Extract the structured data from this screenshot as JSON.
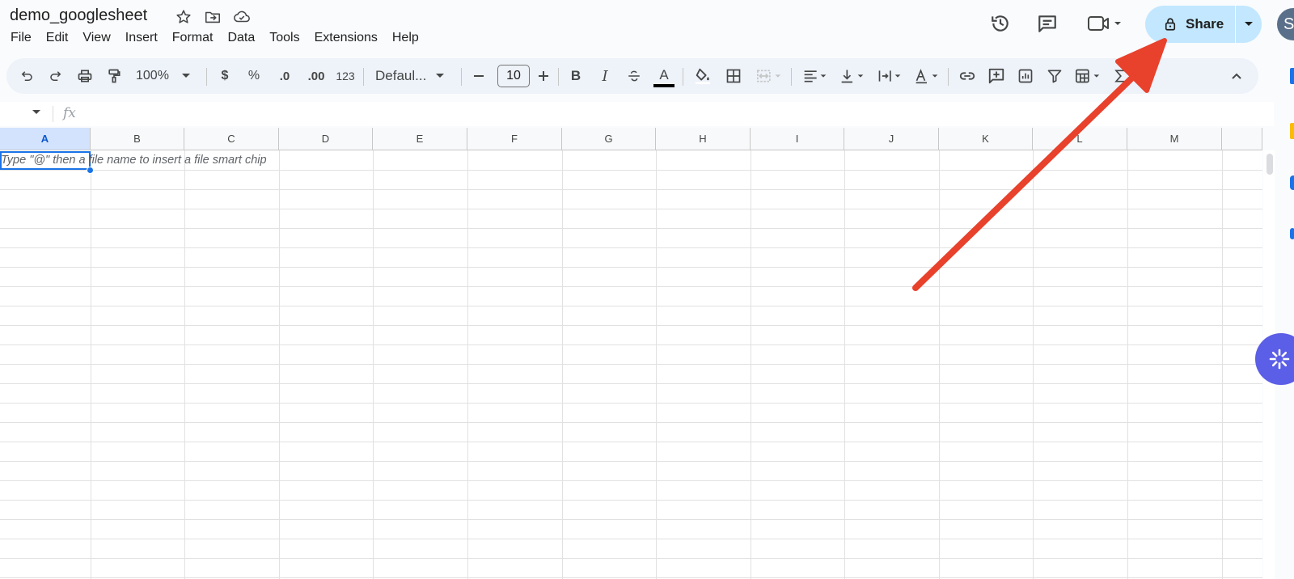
{
  "document": {
    "title": "demo_googlesheet"
  },
  "menu": [
    "File",
    "Edit",
    "View",
    "Insert",
    "Format",
    "Data",
    "Tools",
    "Extensions",
    "Help"
  ],
  "header": {
    "share_label": "Share",
    "avatar_initial": "S",
    "share_color": "#c2e7ff"
  },
  "toolbar": {
    "zoom": "100%",
    "currency": "$",
    "percent": "%",
    "decrease_decimal": ".0",
    "increase_decimal": ".00",
    "number_format": "123",
    "font": "Defaul...",
    "font_size": "10",
    "bold": "B",
    "italic": "I",
    "text_color_glyph": "A"
  },
  "formula_bar": {
    "fx_label": "fx",
    "value": ""
  },
  "sheet": {
    "columns": [
      "A",
      "B",
      "C",
      "D",
      "E",
      "F",
      "G",
      "H",
      "I",
      "J",
      "K",
      "L",
      "M"
    ],
    "active_column": "A",
    "cell_hint": "Type \"@\" then a file name to insert a file smart chip",
    "selection_color": "#1a73e8"
  },
  "annotation": {
    "arrow_color": "#e8412c",
    "points_to": "share-button"
  }
}
